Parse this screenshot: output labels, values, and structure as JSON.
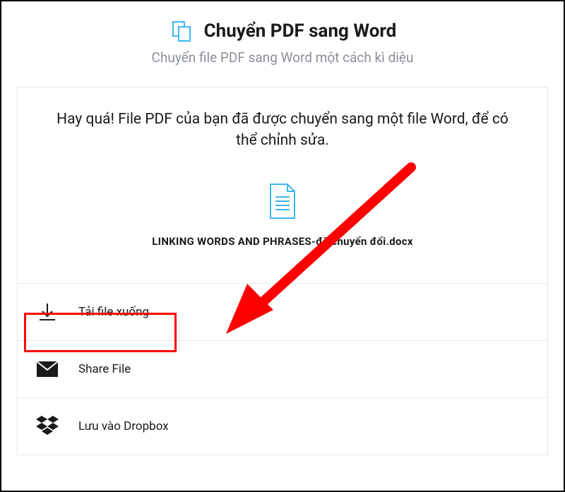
{
  "header": {
    "title": "Chuyển PDF sang Word",
    "subtitle": "Chuyển file PDF sang Word một cách kì diệu"
  },
  "result": {
    "message": "Hay quá! File PDF của bạn đã được chuyển sang một file Word, để có thể chỉnh sửa.",
    "filename": "LINKING WORDS AND PHRASES-đã chuyển đổi.docx"
  },
  "actions": {
    "download": "Tải file xuống",
    "share": "Share File",
    "dropbox": "Lưu vào Dropbox"
  },
  "colors": {
    "accent": "#3fb6f2",
    "highlight": "#ff0000"
  }
}
